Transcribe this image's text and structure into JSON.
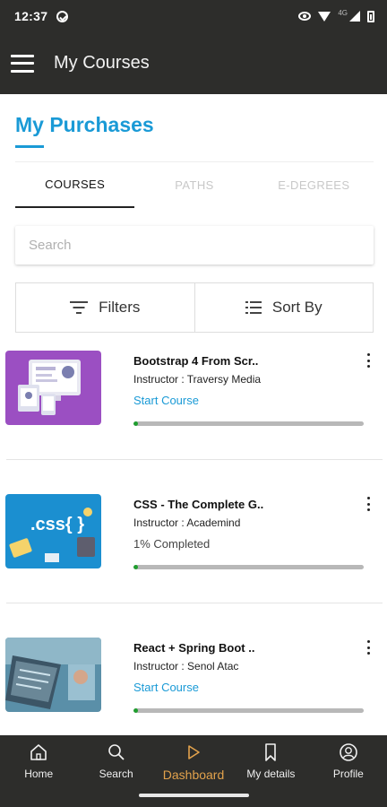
{
  "status_bar": {
    "time": "12:37",
    "network_label": "4G"
  },
  "app_bar": {
    "title": "My Courses"
  },
  "page": {
    "title": "My Purchases"
  },
  "tabs": [
    {
      "label": "COURSES",
      "active": true
    },
    {
      "label": "PATHS",
      "active": false
    },
    {
      "label": "E-DEGREES",
      "active": false
    }
  ],
  "search": {
    "placeholder": "Search",
    "value": ""
  },
  "filters": {
    "filters_label": "Filters",
    "sort_label": "Sort By"
  },
  "courses": [
    {
      "title": "Bootstrap 4 From Scr..",
      "instructor": "Instructor : Traversy Media",
      "action": "Start Course",
      "progress_percent": 0
    },
    {
      "title": "CSS - The Complete G..",
      "instructor": "Instructor : Academind",
      "status": "1% Completed",
      "progress_percent": 1
    },
    {
      "title": "React + Spring Boot ..",
      "instructor": "Instructor : Senol Atac",
      "action": "Start Course",
      "progress_percent": 0
    }
  ],
  "thumbnails": [
    {
      "icon": "design-devices-illustration",
      "text": "",
      "color": "#9b4fc2"
    },
    {
      "icon": "css-code-illustration",
      "text": ".css{ }",
      "color": "#1b8fd0"
    },
    {
      "icon": "laptop-coding-photo",
      "text": "",
      "color": "#5a8fa8"
    }
  ],
  "bottom_nav": [
    {
      "label": "Home",
      "icon": "home-icon",
      "active": false
    },
    {
      "label": "Search",
      "icon": "search-icon",
      "active": false
    },
    {
      "label": "Dashboard",
      "icon": "play-icon",
      "active": true
    },
    {
      "label": "My details",
      "icon": "bookmark-icon",
      "active": false
    },
    {
      "label": "Profile",
      "icon": "profile-icon",
      "active": false
    }
  ],
  "colors": {
    "accent": "#1a9ad6",
    "bar_background": "#2d2d2b",
    "nav_active": "#e2a24c",
    "progress": "#1e9e2e",
    "progress_track": "#b8b8b8"
  }
}
